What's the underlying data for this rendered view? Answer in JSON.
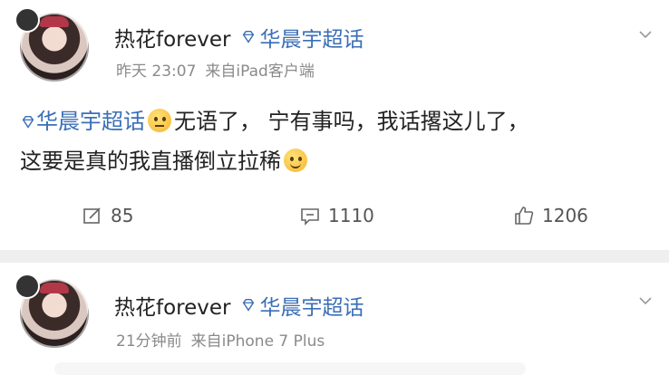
{
  "posts": [
    {
      "username": "热花forever",
      "topic": "华晨宇超话",
      "time": "昨天 23:07",
      "source": "来自iPad客户端",
      "content": {
        "topic": "华晨宇超话",
        "text1": "无语了， 宁有事吗，我话撂这儿了，",
        "text2": "这要是真的我直播倒立拉稀"
      },
      "actions": {
        "repost": "85",
        "comment": "1110",
        "like": "1206"
      }
    },
    {
      "username": "热花forever",
      "topic": "华晨宇超话",
      "time": "21分钟前",
      "source": "来自iPhone 7 Plus"
    }
  ],
  "colors": {
    "link": "#3b6fb6",
    "meta": "#8a8a8a",
    "divider": "#efefef"
  },
  "icons": [
    "diamond-topic-icon",
    "chevron-down-icon",
    "repost-icon",
    "comment-icon",
    "like-icon",
    "emoji-icon"
  ]
}
